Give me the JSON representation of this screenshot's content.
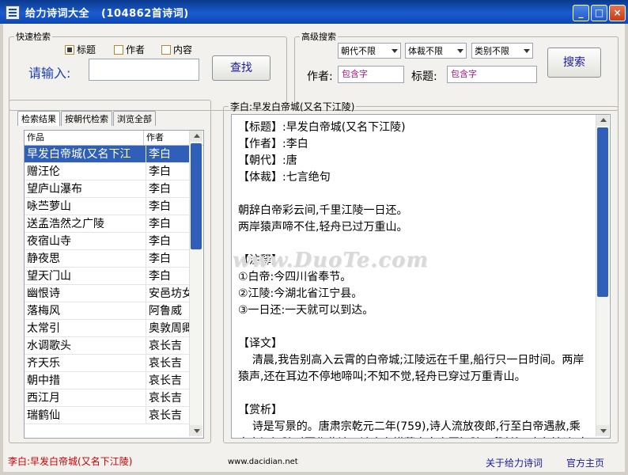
{
  "window": {
    "title": "给力诗词大全",
    "count": "(104862首诗词)"
  },
  "quick_search": {
    "legend": "快速检索",
    "checkboxes": [
      {
        "label": "标题",
        "checked": true
      },
      {
        "label": "作者",
        "checked": false
      },
      {
        "label": "内容",
        "checked": false
      }
    ],
    "input_label": "请输入:",
    "input_value": "",
    "button": "查找"
  },
  "advanced_search": {
    "legend": "高级搜索",
    "dropdowns": [
      "朝代不限",
      "体裁不限",
      "类别不限"
    ],
    "author_label": "作者:",
    "author_placeholder": "包含字",
    "title_label": "标题:",
    "title_placeholder": "包含字",
    "button": "搜索"
  },
  "tabs": [
    "检索结果",
    "按朝代检索",
    "浏览全部"
  ],
  "list": {
    "headers": [
      "作品",
      "作者"
    ],
    "rows": [
      {
        "title": "早发白帝城(又名下江",
        "author": "李白"
      },
      {
        "title": "赠汪伦",
        "author": "李白"
      },
      {
        "title": "望庐山瀑布",
        "author": "李白"
      },
      {
        "title": "咏苎萝山",
        "author": "李白"
      },
      {
        "title": "送孟浩然之广陵",
        "author": "李白"
      },
      {
        "title": "夜宿山寺",
        "author": "李白"
      },
      {
        "title": "静夜思",
        "author": "李白"
      },
      {
        "title": "望天门山",
        "author": "李白"
      },
      {
        "title": "幽恨诗",
        "author": "安邑坊女"
      },
      {
        "title": "落梅风",
        "author": "阿鲁威"
      },
      {
        "title": "太常引",
        "author": "奥敦周卿"
      },
      {
        "title": "水调歌头",
        "author": "哀长吉"
      },
      {
        "title": "齐天乐",
        "author": "哀长吉"
      },
      {
        "title": "朝中措",
        "author": "哀长吉"
      },
      {
        "title": "西江月",
        "author": "哀长吉"
      },
      {
        "title": "瑞鹤仙",
        "author": "哀长吉"
      }
    ]
  },
  "content_panel": {
    "legend": "李白:早发白帝城(又名下江陵)",
    "text": "【标题】:早发白帝城(又名下江陵)\n【作者】:李白\n【朝代】:唐\n【体裁】:七言绝句\n\n朝辞白帝彩云间,千里江陵一日还。\n两岸猿声啼不住,轻舟已过万重山。\n\n【注释】\n①白帝:今四川省奉节。\n②江陵:今湖北省江宁县。\n③一日还:一天就可以到达。\n\n【译文】\n    清晨,我告别高入云霄的白帝城;江陵远在千里,船行只一日时间。两岸猿声,还在耳边不停地啼叫;不知不觉,轻舟已穿过万重青山。\n\n【赏析】\n    诗是写景的。唐肃宗乾元二年(759),诗人流放夜郎,行至白帝遇赦,乘舟东还江陵时而作此诗。诗意在描摹自白帝至江陵一段长江,水急流速,舟行若飞的情况。首句写白帝城之高",
    "watermark": "www.DuoTe.com"
  },
  "status": {
    "current": "李白:早发白帝城(又名下江陵)",
    "website": "www.dacidian.net",
    "about": "关于给力诗词",
    "homepage": "官方主页"
  },
  "colors": {
    "titlebar": "#1a5bd0",
    "selection": "#2f5fb8",
    "status_red": "#cc0000",
    "link_blue": "#1a1a9e"
  }
}
